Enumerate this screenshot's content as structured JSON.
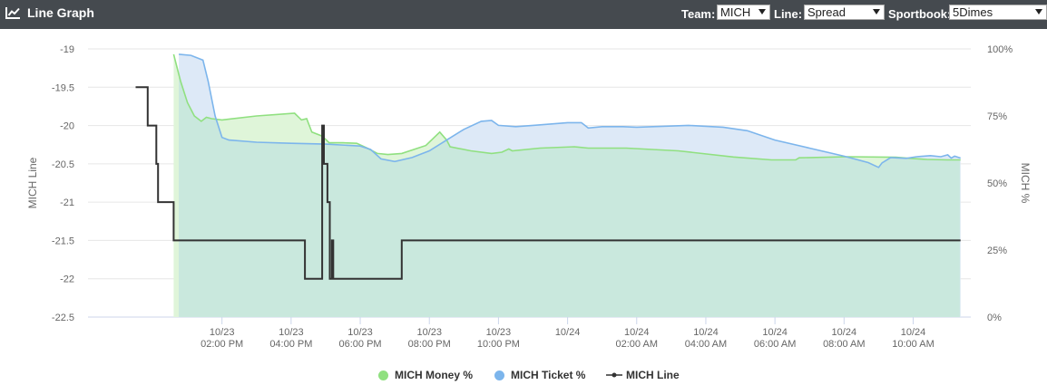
{
  "header": {
    "title": "Line Graph",
    "icon": "line-chart-icon",
    "team_label": "Team:",
    "team_value": "MICH",
    "line_label": "Line:",
    "line_value": "Spread",
    "sportbook_label": "Sportbook:",
    "sportbook_value": "5Dimes"
  },
  "colors": {
    "header_bg": "#454a4f",
    "money": "#90e080",
    "money_fill": "#dff5d9",
    "ticket": "#7cb5ec",
    "ticket_fill": "#dde9f7",
    "overlap_fill": "#c9e8dd",
    "line": "#333333",
    "grid": "#e6e6e6"
  },
  "chart_data": {
    "type": "line",
    "x_domain_hours": [
      11.3,
      35.4
    ],
    "x_ticks": [
      {
        "t": 14,
        "date": "10/23",
        "time": "02:00 PM"
      },
      {
        "t": 16,
        "date": "10/23",
        "time": "04:00 PM"
      },
      {
        "t": 18,
        "date": "10/23",
        "time": "06:00 PM"
      },
      {
        "t": 20,
        "date": "10/23",
        "time": "08:00 PM"
      },
      {
        "t": 22,
        "date": "10/23",
        "time": "10:00 PM"
      },
      {
        "t": 24,
        "date": "10/24",
        "time": ""
      },
      {
        "t": 26,
        "date": "10/24",
        "time": "02:00 AM"
      },
      {
        "t": 28,
        "date": "10/24",
        "time": "04:00 AM"
      },
      {
        "t": 30,
        "date": "10/24",
        "time": "06:00 AM"
      },
      {
        "t": 32,
        "date": "10/24",
        "time": "08:00 AM"
      },
      {
        "t": 34,
        "date": "10/24",
        "time": "10:00 AM"
      }
    ],
    "y_left": {
      "label": "MICH Line",
      "range": [
        -22.5,
        -19
      ],
      "ticks": [
        "-19",
        "-19.5",
        "-20",
        "-20.5",
        "-21",
        "-21.5",
        "-22",
        "-22.5"
      ]
    },
    "y_right": {
      "label": "MICH %",
      "range": [
        0,
        100
      ],
      "ticks": [
        "100%",
        "75%",
        "50%",
        "25%",
        "0%"
      ]
    },
    "legend": "bottom-center",
    "grid": true,
    "series": [
      {
        "name": "MICH Money %",
        "color": "#90e080",
        "points": [
          [
            12.6,
            98
          ],
          [
            12.8,
            88
          ],
          [
            13.0,
            80
          ],
          [
            13.2,
            75
          ],
          [
            13.4,
            73
          ],
          [
            13.55,
            74.5
          ],
          [
            13.7,
            74
          ],
          [
            14.0,
            73.5
          ],
          [
            15.0,
            75
          ],
          [
            16.1,
            76
          ],
          [
            16.3,
            73.5
          ],
          [
            16.45,
            74
          ],
          [
            16.6,
            69
          ],
          [
            16.9,
            67.5
          ],
          [
            17.1,
            65
          ],
          [
            17.5,
            65
          ],
          [
            17.9,
            64.8
          ],
          [
            18.2,
            63
          ],
          [
            18.5,
            61
          ],
          [
            18.8,
            60.6
          ],
          [
            19.2,
            61
          ],
          [
            19.9,
            64
          ],
          [
            20.3,
            69
          ],
          [
            20.5,
            66
          ],
          [
            20.6,
            63.5
          ],
          [
            21.2,
            62
          ],
          [
            21.8,
            61
          ],
          [
            22.1,
            61.5
          ],
          [
            22.3,
            62.7
          ],
          [
            22.4,
            62
          ],
          [
            23.2,
            63
          ],
          [
            24.2,
            63.5
          ],
          [
            24.6,
            63
          ],
          [
            25.7,
            63
          ],
          [
            27.2,
            62
          ],
          [
            28.8,
            59.7
          ],
          [
            29.9,
            58.6
          ],
          [
            30.6,
            58.6
          ],
          [
            30.7,
            59.4
          ],
          [
            32.1,
            59.8
          ],
          [
            33.5,
            59.6
          ],
          [
            33.9,
            59.2
          ],
          [
            34.4,
            58.8
          ],
          [
            35.0,
            58.6
          ],
          [
            35.37,
            58.6
          ]
        ]
      },
      {
        "name": "MICH Ticket %",
        "color": "#7cb5ec",
        "points": [
          [
            12.75,
            98
          ],
          [
            13.1,
            97.6
          ],
          [
            13.45,
            95.8
          ],
          [
            13.6,
            88
          ],
          [
            13.8,
            75
          ],
          [
            14.0,
            67
          ],
          [
            14.2,
            66
          ],
          [
            15.0,
            65.2
          ],
          [
            16.0,
            64.8
          ],
          [
            17.0,
            64.5
          ],
          [
            18.0,
            63.8
          ],
          [
            18.3,
            62.5
          ],
          [
            18.6,
            59
          ],
          [
            19.0,
            58
          ],
          [
            19.5,
            59.5
          ],
          [
            20.0,
            62
          ],
          [
            20.5,
            66
          ],
          [
            21.0,
            70
          ],
          [
            21.5,
            73
          ],
          [
            21.8,
            73.3
          ],
          [
            22.0,
            71.5
          ],
          [
            22.5,
            71
          ],
          [
            23.0,
            71.5
          ],
          [
            24.0,
            72.5
          ],
          [
            24.4,
            72.5
          ],
          [
            24.6,
            70.5
          ],
          [
            25.0,
            71
          ],
          [
            25.6,
            71
          ],
          [
            26.0,
            70.8
          ],
          [
            27.5,
            71.5
          ],
          [
            28.5,
            70.8
          ],
          [
            29.2,
            69.5
          ],
          [
            30.0,
            66
          ],
          [
            31.0,
            63
          ],
          [
            32.0,
            60
          ],
          [
            32.7,
            57.6
          ],
          [
            33.0,
            55.8
          ],
          [
            33.1,
            57.5
          ],
          [
            33.35,
            59.5
          ],
          [
            33.8,
            59.2
          ],
          [
            34.1,
            59.8
          ],
          [
            34.5,
            60.2
          ],
          [
            34.8,
            59.8
          ],
          [
            35.0,
            60.5
          ],
          [
            35.1,
            59.3
          ],
          [
            35.2,
            60
          ],
          [
            35.37,
            59.3
          ]
        ]
      },
      {
        "name": "MICH Line",
        "color": "#333333",
        "points": [
          [
            11.5,
            -19.5
          ],
          [
            11.85,
            -19.5
          ],
          [
            11.85,
            -20
          ],
          [
            12.1,
            -20
          ],
          [
            12.1,
            -20.5
          ],
          [
            12.15,
            -20.5
          ],
          [
            12.15,
            -21
          ],
          [
            12.6,
            -21
          ],
          [
            12.6,
            -21.5
          ],
          [
            16.4,
            -21.5
          ],
          [
            16.4,
            -22
          ],
          [
            16.9,
            -22
          ],
          [
            16.9,
            -20
          ],
          [
            16.95,
            -20
          ],
          [
            16.95,
            -20.5
          ],
          [
            17.05,
            -20.5
          ],
          [
            17.05,
            -21
          ],
          [
            17.12,
            -21
          ],
          [
            17.12,
            -22
          ],
          [
            17.18,
            -22
          ],
          [
            17.18,
            -21.5
          ],
          [
            17.22,
            -21.5
          ],
          [
            17.22,
            -22
          ],
          [
            19.2,
            -22
          ],
          [
            19.2,
            -21.5
          ],
          [
            24.0,
            -21.5
          ],
          [
            35.37,
            -21.5
          ]
        ]
      }
    ]
  },
  "legend_items": {
    "money": "MICH Money %",
    "ticket": "MICH Ticket %",
    "line": "MICH Line"
  }
}
